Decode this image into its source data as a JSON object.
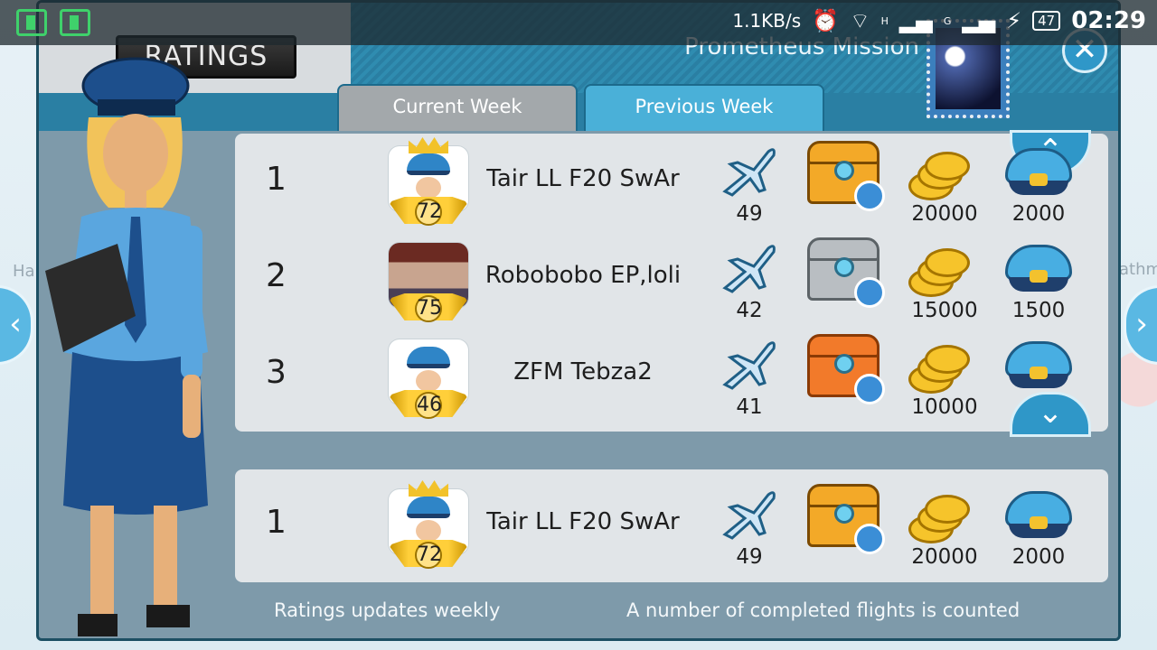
{
  "status_bar": {
    "net_speed": "1.1KB/s",
    "signal_h": "H",
    "signal_g": "G",
    "battery": "47",
    "time": "02:29",
    "icons": [
      "download-notification-icon",
      "screen-cast-icon",
      "alarm-icon",
      "wifi-icon",
      "signal-icon",
      "charging-icon"
    ]
  },
  "background": {
    "map_text_left": "Ha",
    "map_text_right": "athm"
  },
  "dialog": {
    "title": "RATINGS",
    "mission_title": "Prometheus Mission",
    "close_glyph": "✕",
    "tabs": [
      {
        "label": "Current Week",
        "active": false
      },
      {
        "label": "Previous Week",
        "active": true
      }
    ],
    "scroll_up_glyph": "⌃",
    "scroll_down_glyph": "⌄",
    "rows": [
      {
        "rank": "1",
        "name": "Tair LL F20 SwAr",
        "level": "72",
        "avatar": "pilot-crown",
        "flights": "49",
        "chest": "gold",
        "coins": "20000",
        "hats": "2000"
      },
      {
        "rank": "2",
        "name": "Robobobo EP,loli",
        "level": "75",
        "avatar": "photo",
        "flights": "42",
        "chest": "silver",
        "coins": "15000",
        "hats": "1500"
      },
      {
        "rank": "3",
        "name": "ZFM Tebza2",
        "level": "46",
        "avatar": "pilot",
        "flights": "41",
        "chest": "bronze",
        "coins": "10000",
        "hats": ""
      }
    ],
    "my_row": {
      "rank": "1",
      "name": "Tair LL F20 SwAr",
      "level": "72",
      "avatar": "pilot-crown",
      "flights": "49",
      "chest": "gold",
      "coins": "20000",
      "hats": "2000"
    },
    "footer_left": "Ratings updates weekly",
    "footer_right": "A number of completed flights is counted"
  },
  "nav": {
    "left_glyph": "‹",
    "right_glyph": "›"
  }
}
